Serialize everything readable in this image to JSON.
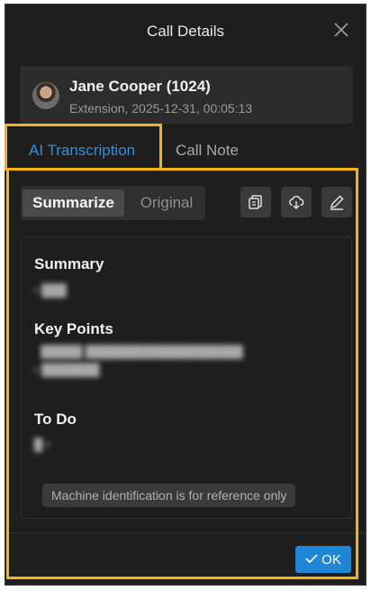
{
  "dialog": {
    "title": "Call Details",
    "close_icon": "close-icon"
  },
  "caller": {
    "name": "Jane Cooper (1024)",
    "details": "Extension, 2025-12-31, 00:05:13"
  },
  "tabs": [
    {
      "label": "AI Transcription",
      "active": true
    },
    {
      "label": "Call Note",
      "active": false
    }
  ],
  "view_toggle": {
    "summarize_label": "Summarize",
    "original_label": "Original",
    "selected": "Summarize"
  },
  "toolbar_icons": [
    "copy-icon",
    "download-icon",
    "edit-icon"
  ],
  "summary": {
    "summary_heading": "Summary",
    "key_points_heading": "Key Points",
    "todo_heading": "To Do",
    "disclaimer": "Machine identification is for reference only"
  },
  "footer": {
    "ok_label": "OK"
  },
  "colors": {
    "accent": "#1f86d6",
    "highlight": "#f2b418",
    "background": "#1e1e1e"
  }
}
